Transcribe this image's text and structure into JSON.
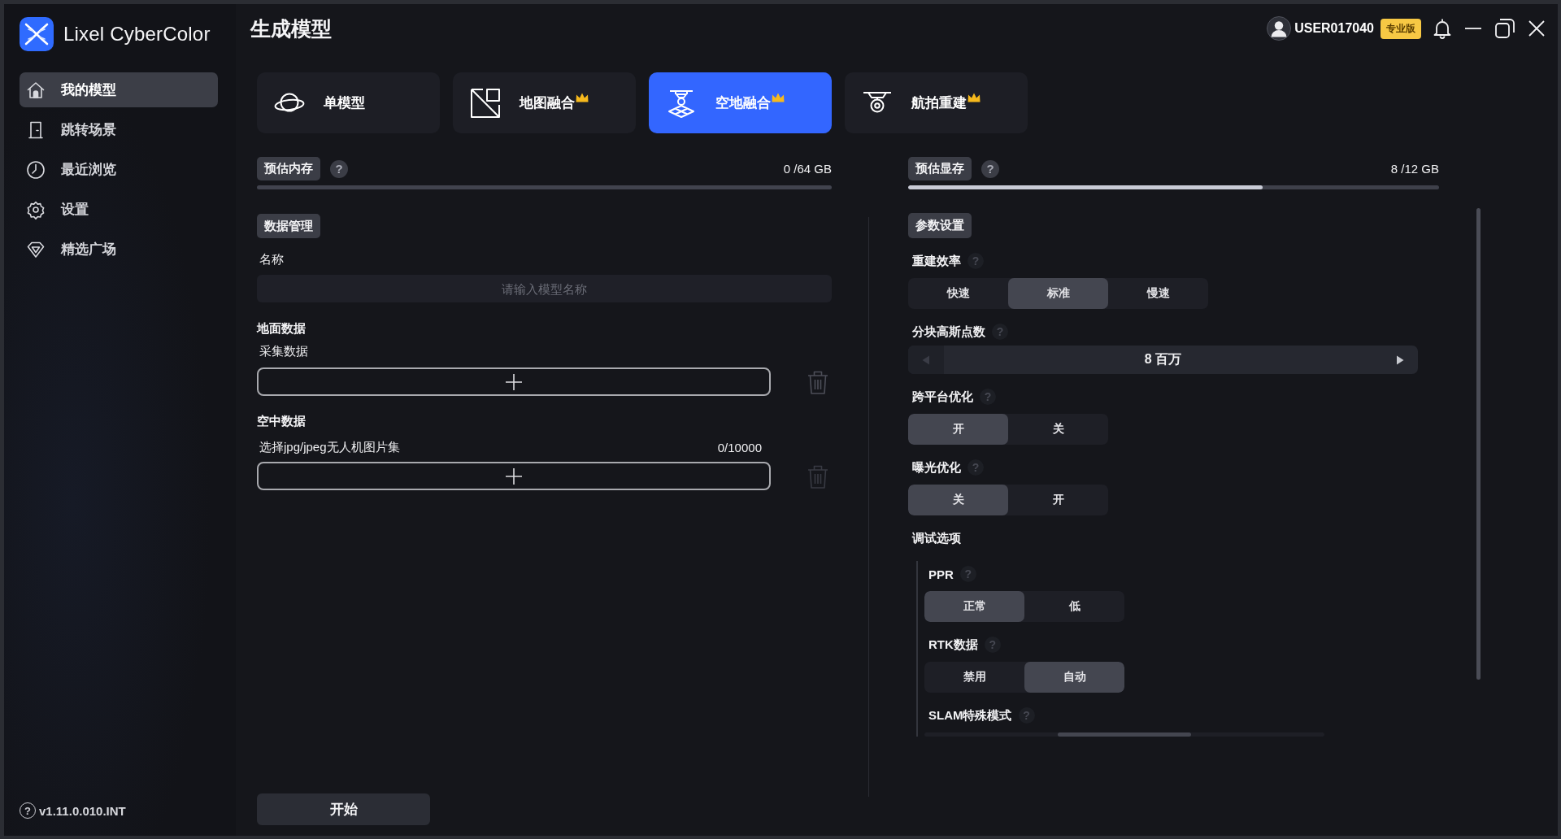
{
  "app": {
    "name": "Lixel CyberColor"
  },
  "sidebar": {
    "items": [
      {
        "label": "我的模型",
        "selected": true
      },
      {
        "label": "跳转场景",
        "selected": false
      },
      {
        "label": "最近浏览",
        "selected": false
      },
      {
        "label": "设置",
        "selected": false
      },
      {
        "label": "精选广场",
        "selected": false
      }
    ],
    "version": {
      "help": "?",
      "text": "v1.11.0.010.INT"
    }
  },
  "header": {
    "title": "生成模型",
    "user": {
      "name": "USER017040",
      "badge": "专业版"
    }
  },
  "mode_tabs": [
    {
      "label": "单模型",
      "selected": false,
      "premium": false
    },
    {
      "label": "地图融合",
      "selected": false,
      "premium": true
    },
    {
      "label": "空地融合",
      "selected": true,
      "premium": true
    },
    {
      "label": "航拍重建",
      "selected": false,
      "premium": true
    }
  ],
  "memory": {
    "label": "预估内存",
    "help": "?",
    "reading": "0 /64 GB"
  },
  "data_management": {
    "title": "数据管理",
    "name_label": "名称",
    "name_field": {
      "placeholder": "请输入模型名称"
    },
    "ground": {
      "title": "地面数据",
      "label": "采集数据"
    },
    "aerial": {
      "title": "空中数据",
      "label": "选择jpg/jpeg无人机图片集",
      "count": "0/10000"
    }
  },
  "start_button": "开始",
  "vram": {
    "label": "预估显存",
    "help": "?",
    "reading": "8 /12 GB",
    "level": 0.667
  },
  "parameters": {
    "title": "参数设置",
    "settings": [
      {
        "kind": "segmented",
        "label": "重建效率",
        "help": "?",
        "options": [
          {
            "label": "快速",
            "selected": false
          },
          {
            "label": "标准",
            "selected": true
          },
          {
            "label": "慢速",
            "selected": false
          }
        ]
      },
      {
        "kind": "stepper",
        "label": "分块高斯点数",
        "help": "?",
        "value": "8 百万",
        "prev_disabled": true,
        "next_disabled": false
      },
      {
        "kind": "segmented",
        "label": "跨平台优化",
        "help": "?",
        "options": [
          {
            "label": "开",
            "selected": true
          },
          {
            "label": "关",
            "selected": false
          }
        ]
      },
      {
        "kind": "segmented",
        "label": "曝光优化",
        "help": "?",
        "options": [
          {
            "label": "关",
            "selected": true
          },
          {
            "label": "开",
            "selected": false
          }
        ]
      },
      {
        "kind": "group",
        "label": "调试选项",
        "children": [
          {
            "kind": "segmented",
            "label": "PPR",
            "help": "?",
            "options": [
              {
                "label": "正常",
                "selected": true
              },
              {
                "label": "低",
                "selected": false
              }
            ]
          },
          {
            "kind": "segmented",
            "label": "RTK数据",
            "help": "?",
            "options": [
              {
                "label": "禁用",
                "selected": false
              },
              {
                "label": "自动",
                "selected": true
              }
            ]
          },
          {
            "kind": "segmented",
            "label": "SLAM特殊模式",
            "help": "?",
            "options": [
              {
                "selected": false
              },
              {
                "selected": true
              },
              {
                "selected": false
              }
            ]
          }
        ]
      }
    ]
  }
}
